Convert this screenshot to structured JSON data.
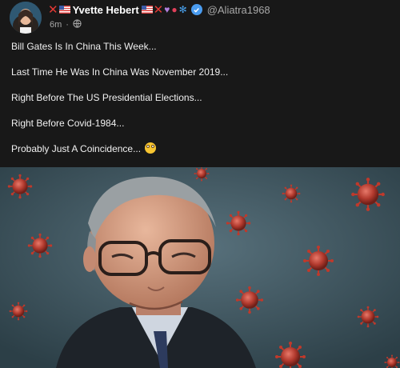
{
  "post": {
    "author": {
      "display_name": "Yvette Hebert",
      "handle": "@Aliatra1968",
      "name_prefix_icons": [
        "red-x-icon",
        "us-flag-icon"
      ],
      "name_suffix_icons": [
        "us-flag-icon",
        "red-x-icon",
        "purple-heart-icon",
        "lips-icon",
        "blue-butterfly-icon"
      ],
      "verified": true
    },
    "time_ago": "6m",
    "visibility_icon": "globe-icon",
    "lines": [
      "Bill Gates Is In China This Week...",
      "Last Time He Was In China Was November 2019...",
      "Right Before The US Presidential Elections...",
      "Right Before Covid-1984...",
      "Probably Just A Coincidence..."
    ],
    "line_end_emoji": "rolling-eyes-icon"
  },
  "colors": {
    "background": "#181818",
    "verified": "#4a9cf0",
    "virus_red": "#c0392b",
    "photo_bg": "#3d5560"
  }
}
